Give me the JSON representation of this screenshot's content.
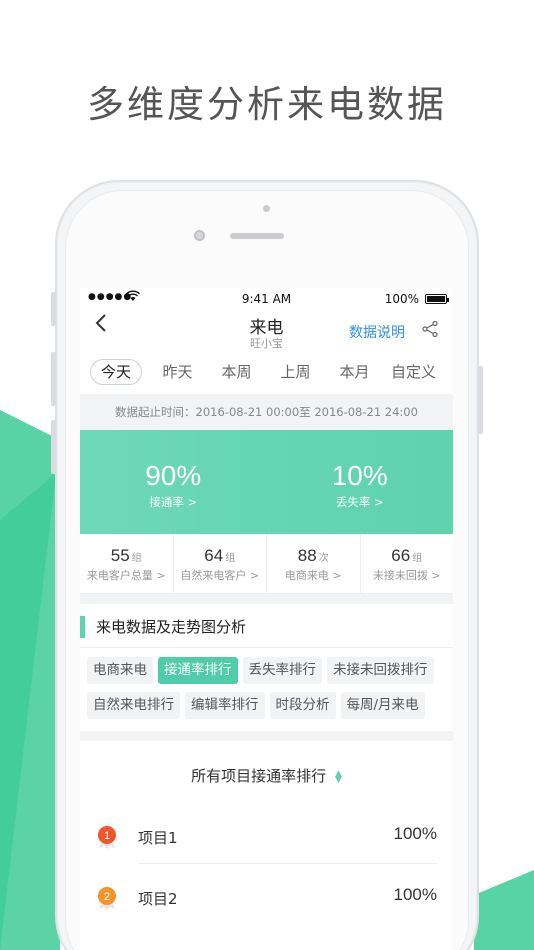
{
  "headline": "多维度分析来电数据",
  "status_bar": {
    "time": "9:41 AM",
    "battery": "100%"
  },
  "nav": {
    "title": "来电",
    "subtitle": "旺小宝",
    "explain": "数据说明"
  },
  "tabs": [
    "今天",
    "昨天",
    "本周",
    "上周",
    "本月",
    "自定义"
  ],
  "range_text": "数据起止时间：2016-08-21 00:00至 2016-08-21 24:00",
  "rates": [
    {
      "value": "90%",
      "label": "接通率 >"
    },
    {
      "value": "10%",
      "label": "丢失率 >"
    }
  ],
  "counts": [
    {
      "value": "55",
      "unit": "组",
      "label": "来电客户总量 >"
    },
    {
      "value": "64",
      "unit": "组",
      "label": "自然来电客户 >"
    },
    {
      "value": "88",
      "unit": "次",
      "label": "电商来电 >"
    },
    {
      "value": "66",
      "unit": "组",
      "label": "未接未回拨 >"
    }
  ],
  "section_title": "来电数据及走势图分析",
  "chips": [
    {
      "label": "电商来电",
      "active": false
    },
    {
      "label": "接通率排行",
      "active": true
    },
    {
      "label": "丢失率排行",
      "active": false
    },
    {
      "label": "未接未回拨排行",
      "active": false
    },
    {
      "label": "自然来电排行",
      "active": false
    },
    {
      "label": "编辑率排行",
      "active": false
    },
    {
      "label": "时段分析",
      "active": false
    },
    {
      "label": "每周/月来电",
      "active": false
    }
  ],
  "rank_title": "所有项目接通率排行",
  "ranks": [
    {
      "rank": "1",
      "name": "项目1",
      "pct": "100%",
      "color": "#f0562e"
    },
    {
      "rank": "2",
      "name": "项目2",
      "pct": "100%",
      "color": "#f5922a"
    }
  ],
  "colors": {
    "accent": "#5fd2ae",
    "link": "#2f8fe0",
    "background_shape": "#4fcf9f"
  },
  "icons": {
    "back": "chevron-left-icon",
    "share": "share-icon",
    "sort": "sort-arrows-icon"
  }
}
